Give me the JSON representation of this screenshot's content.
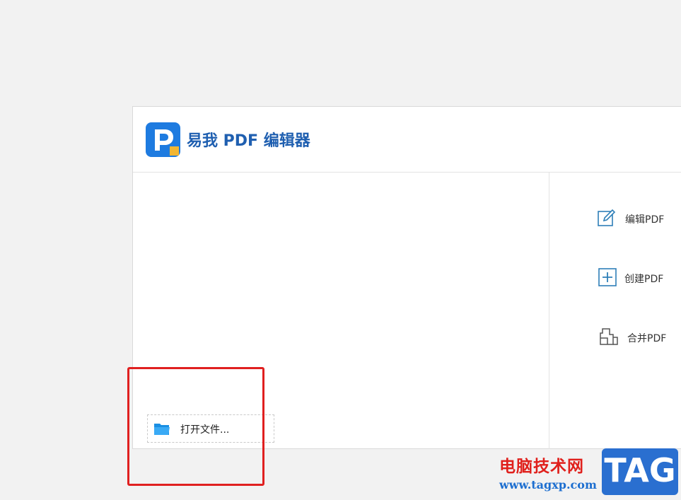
{
  "app": {
    "title": "易我 PDF 编辑器",
    "brand_color": "#1f5fb0"
  },
  "open_file": {
    "label": "打开文件...",
    "icon": "folder-icon"
  },
  "actions": [
    {
      "label": "编辑PDF",
      "icon": "edit-pdf-icon"
    },
    {
      "label": "创建PDF",
      "icon": "create-pdf-icon"
    },
    {
      "label": "合并PDF",
      "icon": "merge-pdf-icon"
    }
  ],
  "annotation": {
    "highlight_color": "#e02020"
  },
  "watermark": {
    "site_name": "电脑技术网",
    "url": "www.tagxp.com",
    "badge": "TAG"
  }
}
